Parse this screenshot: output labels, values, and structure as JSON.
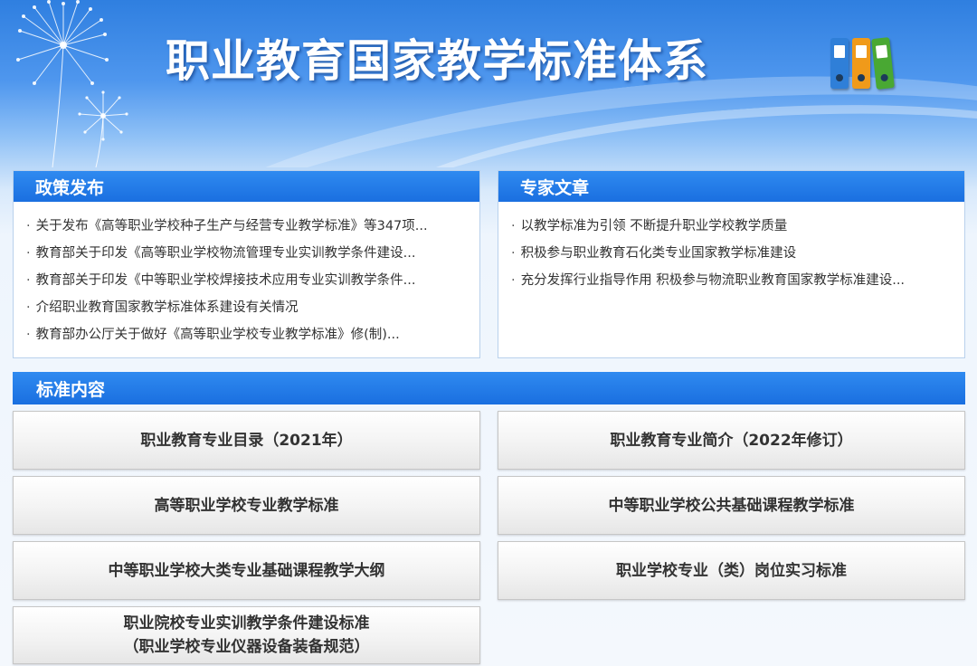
{
  "header": {
    "title": "职业教育国家教学标准体系",
    "icon": "binders-icon",
    "binder_colors": [
      "#2f7fd8",
      "#f09a1a",
      "#49a833"
    ]
  },
  "policy": {
    "title": "政策发布",
    "items": [
      "关于发布《高等职业学校种子生产与经营专业教学标准》等347项...",
      "教育部关于印发《高等职业学校物流管理专业实训教学条件建设...",
      "教育部关于印发《中等职业学校焊接技术应用专业实训教学条件...",
      "介绍职业教育国家教学标准体系建设有关情况",
      "教育部办公厅关于做好《高等职业学校专业教学标准》修(制)..."
    ]
  },
  "expert": {
    "title": "专家文章",
    "items": [
      "以教学标准为引领 不断提升职业学校教学质量",
      "积极参与职业教育石化类专业国家教学标准建设",
      "充分发挥行业指导作用 积极参与物流职业教育国家教学标准建设..."
    ]
  },
  "standards": {
    "title": "标准内容",
    "buttons": [
      "职业教育专业目录（2021年）",
      "职业教育专业简介（2022年修订）",
      "高等职业学校专业教学标准",
      "中等职业学校公共基础课程教学标准",
      "中等职业学校大类专业基础课程教学大纲",
      "职业学校专业（类）岗位实习标准"
    ],
    "last_button": {
      "line1": "职业院校专业实训教学条件建设标准",
      "line2": "（职业学校专业仪器设备装备规范）"
    }
  },
  "colors": {
    "accent": "#1a6fe0",
    "header_top": "#2f7fe0",
    "button_text": "#333333"
  }
}
